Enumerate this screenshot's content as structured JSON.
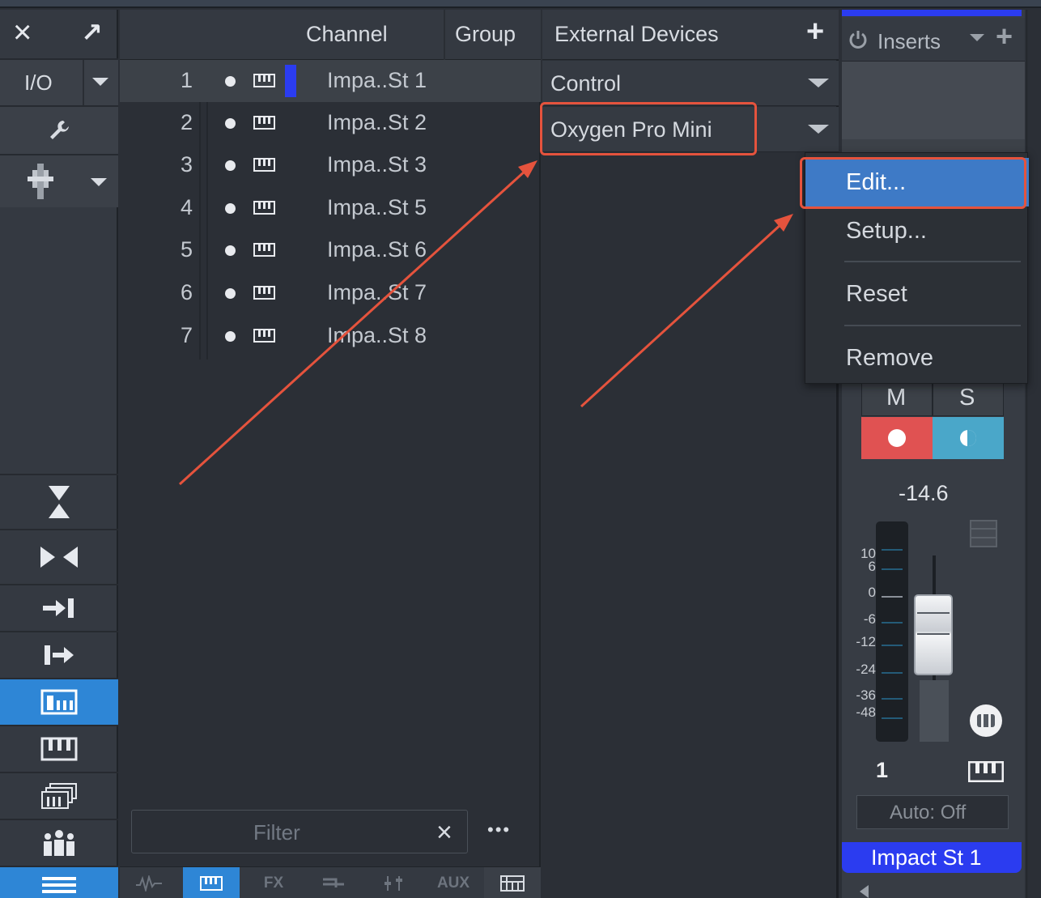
{
  "toolbar": {
    "close_icon": "×",
    "expand_icon": "↗"
  },
  "left": {
    "io_label": "I/O"
  },
  "channel_list": {
    "header_channel": "Channel",
    "header_group": "Group",
    "rows": [
      {
        "num": "1",
        "name": "Impa..St 1"
      },
      {
        "num": "2",
        "name": "Impa..St 2"
      },
      {
        "num": "3",
        "name": "Impa..St 3"
      },
      {
        "num": "4",
        "name": "Impa..St 5"
      },
      {
        "num": "5",
        "name": "Impa..St 6"
      },
      {
        "num": "6",
        "name": "Impa..St 7"
      },
      {
        "num": "7",
        "name": "Impa..St 8"
      }
    ],
    "filter_placeholder": "Filter",
    "filter_clear": "×",
    "more": "•••",
    "bottom_tabs": {
      "fx": "FX",
      "aux": "AUX"
    }
  },
  "external_devices": {
    "title": "External Devices",
    "add": "+",
    "devices": [
      "Control",
      "Oxygen Pro Mini"
    ]
  },
  "context_menu": {
    "items": [
      "Edit...",
      "Setup...",
      "Reset",
      "Remove"
    ]
  },
  "strip": {
    "inserts_label": "Inserts",
    "mute": "M",
    "solo": "S",
    "volume": "-14.6",
    "meter_scale": [
      "10",
      "6",
      "0",
      "-6",
      "-12",
      "-24",
      "-36",
      "-48"
    ],
    "channel_number": "1",
    "automation": "Auto: Off",
    "channel_name": "Impact St 1"
  },
  "colors": {
    "accent_blue": "#2e86d6",
    "record_red": "#e05252",
    "monitor_teal": "#4aa7c9",
    "highlight_red": "#e5533d",
    "channel_color": "#2b3cf0"
  }
}
